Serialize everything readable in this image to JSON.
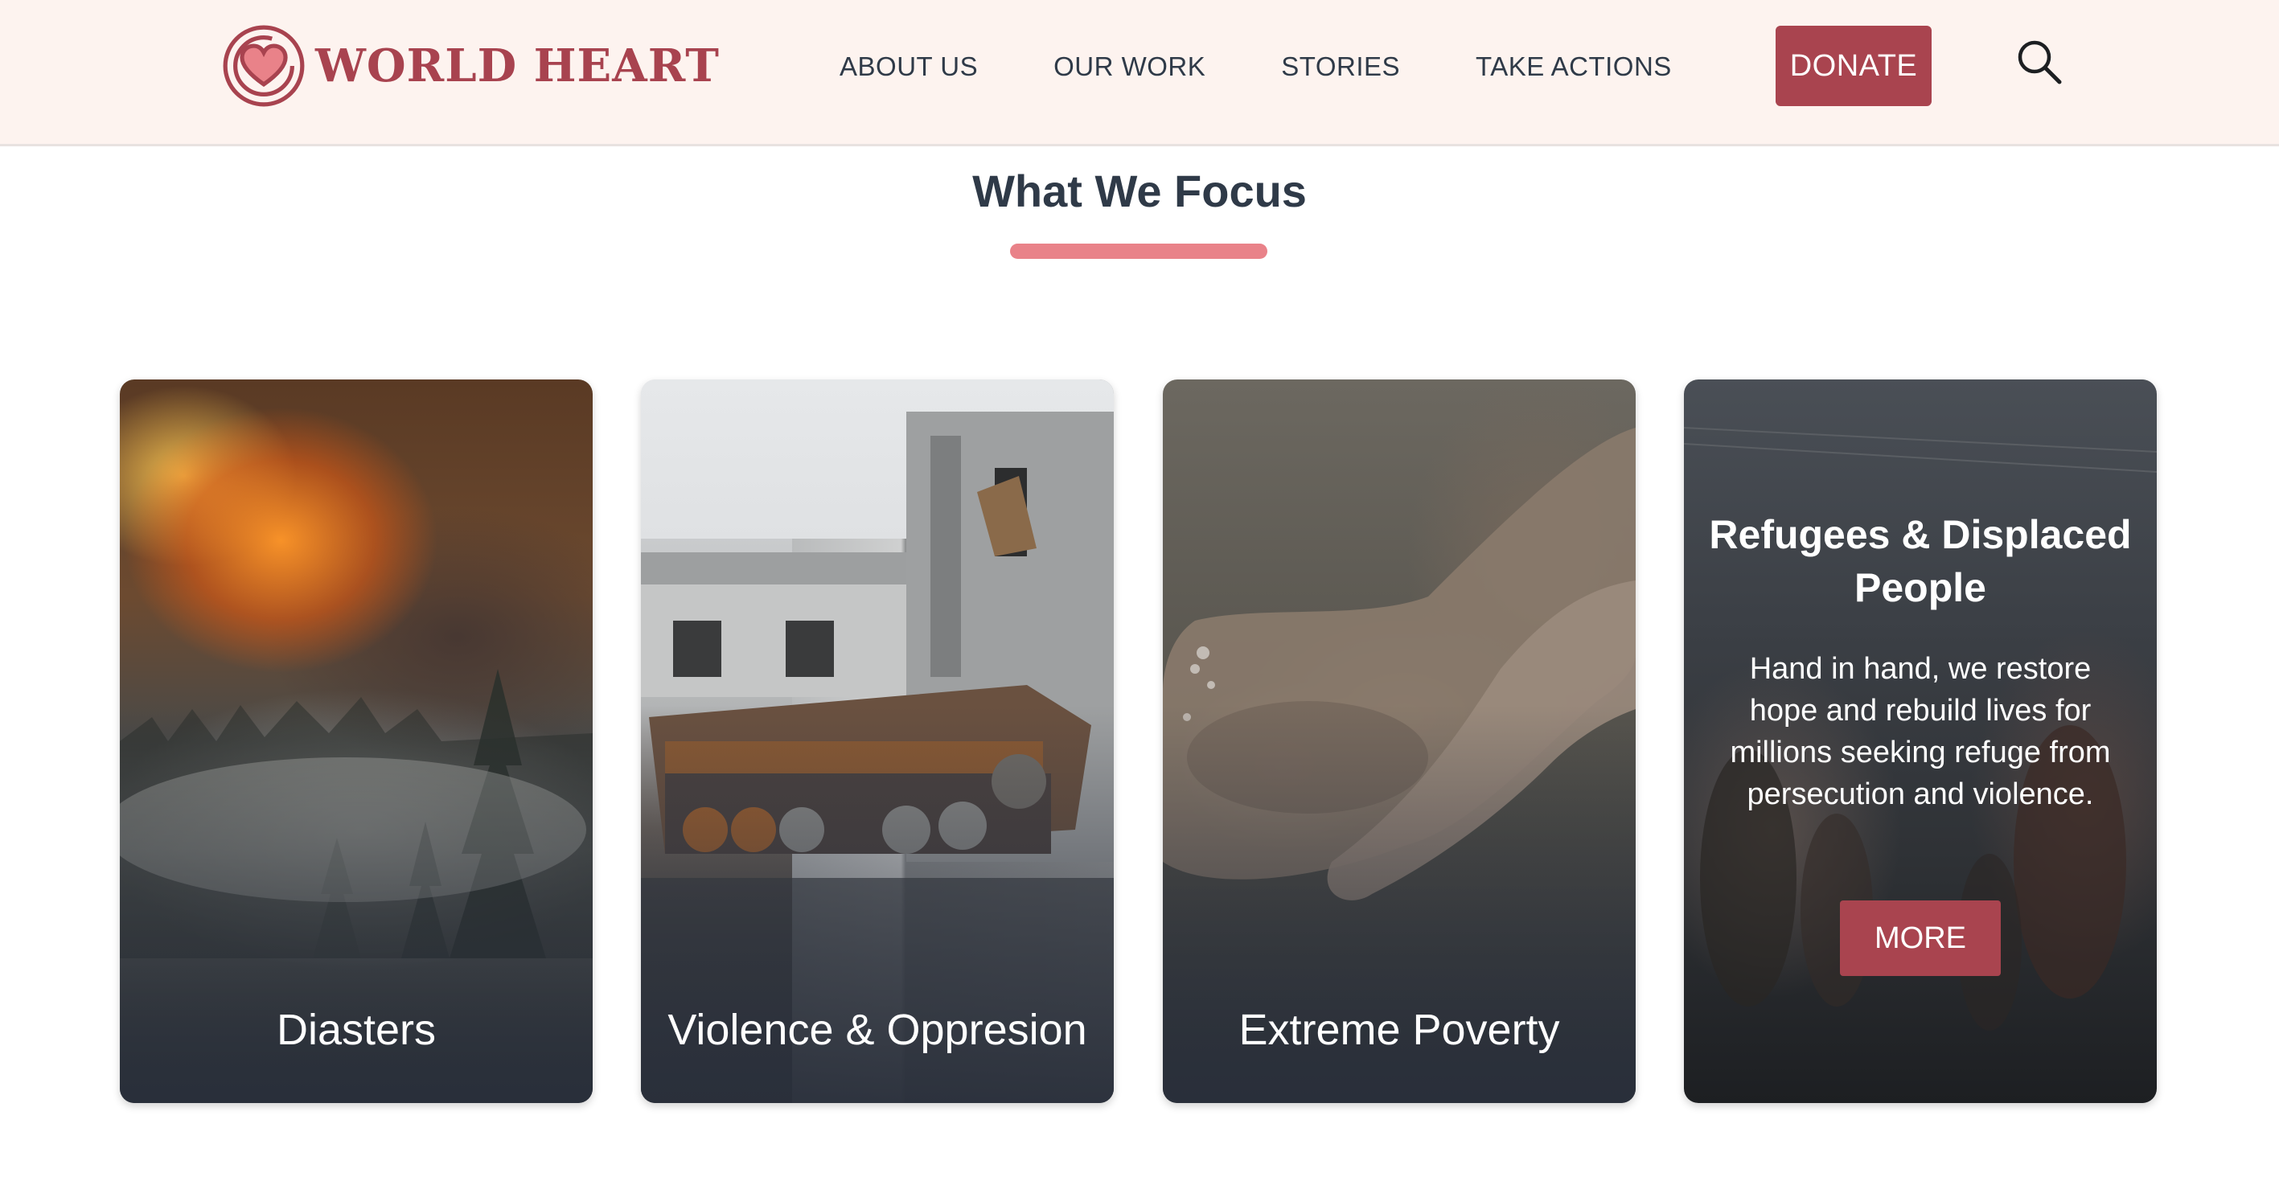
{
  "header": {
    "logo_text": "WORLD HEART",
    "nav": [
      {
        "label": "ABOUT US"
      },
      {
        "label": "OUR WORK"
      },
      {
        "label": "STORIES"
      },
      {
        "label": "TAKE ACTIONS"
      }
    ],
    "donate_label": "DONATE",
    "search_icon": "search-icon"
  },
  "section": {
    "title": "What We Focus"
  },
  "cards": [
    {
      "title": "Diasters",
      "image": "wildfire-image"
    },
    {
      "title": "Violence & Oppresion",
      "image": "ruined-building-tank-image"
    },
    {
      "title": "Extreme Poverty",
      "image": "cupped-hands-image"
    },
    {
      "title": "Refugees & Displaced People",
      "description": "Hand in hand, we restore hope and rebuild lives for millions seeking refuge from persecution and violence.",
      "button_label": "MORE",
      "image": "refugees-crowd-image"
    }
  ],
  "colors": {
    "brand": "#a9444f",
    "header_bg": "#fdf3ef",
    "text_dark": "#2f3a48",
    "underline": "#e98289"
  }
}
